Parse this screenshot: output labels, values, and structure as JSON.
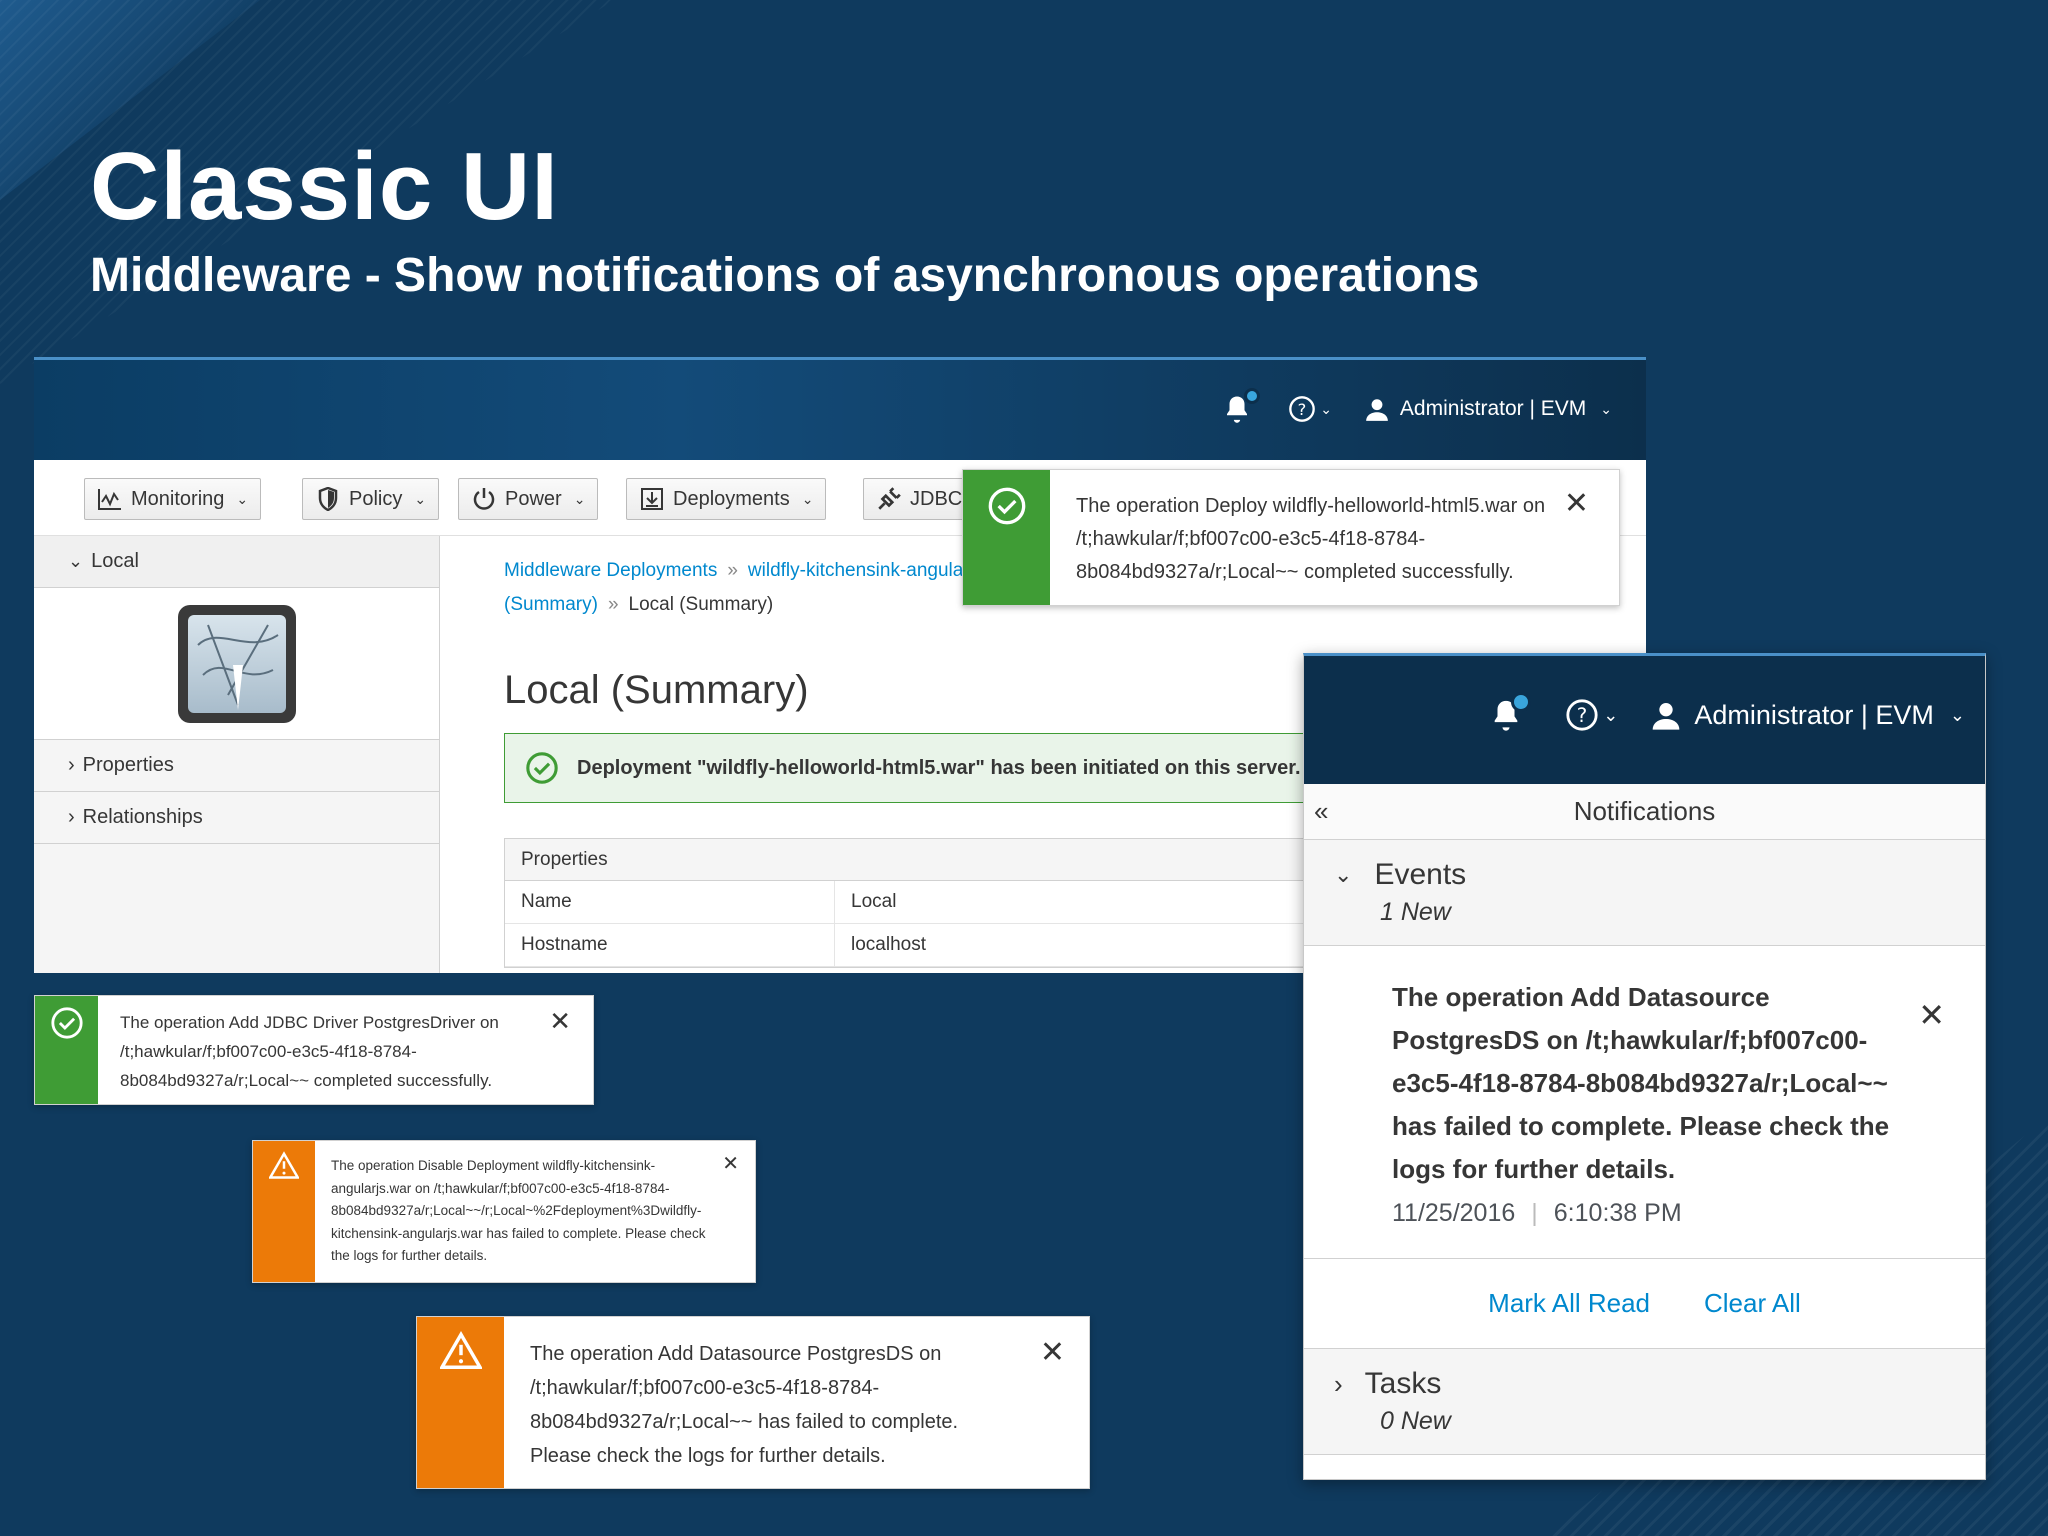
{
  "slide": {
    "title": "Classic UI",
    "subtitle": "Middleware - Show notifications of asynchronous operations"
  },
  "main": {
    "user_label": "Administrator | EVM",
    "toolbar": {
      "monitoring": "Monitoring",
      "policy": "Policy",
      "power": "Power",
      "deployments": "Deployments",
      "jdbc": "JDBC"
    },
    "sidebar": {
      "section": "Local",
      "items": [
        "Properties",
        "Relationships"
      ]
    },
    "breadcrumb": {
      "first": "Middleware Deployments",
      "second": "wildfly-kitchensink-angularjs.war",
      "second_cont": "(Summary)",
      "current": "Local (Summary)"
    },
    "page_title": "Local (Summary)",
    "flash_message": "Deployment \"wildfly-helloworld-html5.war\" has been initiated on this server.",
    "properties": {
      "header": "Properties",
      "rows": [
        {
          "key": "Name",
          "value": "Local"
        },
        {
          "key": "Hostname",
          "value": "localhost"
        }
      ]
    }
  },
  "toasts": {
    "deploy_success": "The operation Deploy wildfly-helloworld-html5.war on /t;hawkular/f;bf007c00-e3c5-4f18-8784-8b084bd9327a/r;Local~~ completed successfully.",
    "jdbc_success": "The operation Add JDBC Driver PostgresDriver on /t;hawkular/f;bf007c00-e3c5-4f18-8784-8b084bd9327a/r;Local~~ completed successfully.",
    "disable_failed": "The operation Disable Deployment wildfly-kitchensink-angularjs.war on /t;hawkular/f;bf007c00-e3c5-4f18-8784-8b084bd9327a/r;Local~~/r;Local~%2Fdeployment%3Dwildfly-kitchensink-angularjs.war has failed to complete. Please check the logs for further details.",
    "datasource_failed": "The operation Add Datasource PostgresDS on /t;hawkular/f;bf007c00-e3c5-4f18-8784-8b084bd9327a/r;Local~~ has failed to complete. Please check the logs for further details."
  },
  "drawer": {
    "user_label": "Administrator | EVM",
    "title": "Notifications",
    "events": {
      "label": "Events",
      "count": "1 New"
    },
    "notification": {
      "text": "The operation Add Datasource PostgresDS on /t;hawkular/f;bf007c00-e3c5-4f18-8784-8b084bd9327a/r;Local~~ has failed to complete. Please check the logs for further details.",
      "date": "11/25/2016",
      "time": "6:10:38 PM"
    },
    "actions": {
      "mark_all_read": "Mark All Read",
      "clear_all": "Clear All"
    },
    "tasks": {
      "label": "Tasks",
      "count": "0 New"
    }
  },
  "colors": {
    "background": "#0f3a5e",
    "success": "#3f9c35",
    "warning": "#ec7a08",
    "link": "#0088ce"
  }
}
